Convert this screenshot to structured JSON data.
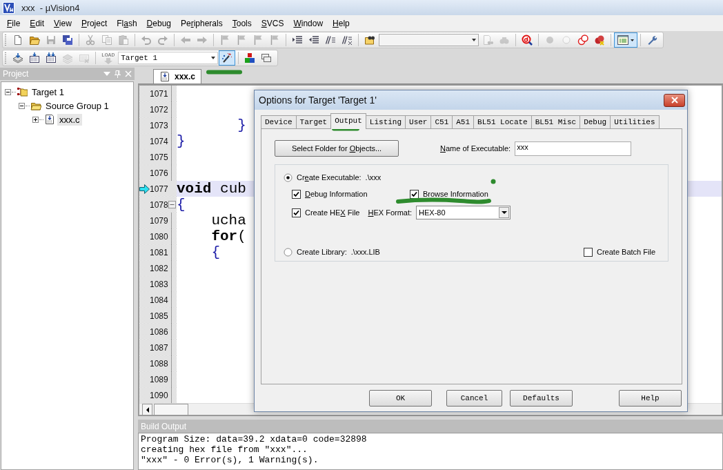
{
  "window": {
    "title": "xxx  - µVision4"
  },
  "menu": [
    {
      "key": "F",
      "tail": "ile"
    },
    {
      "key": "E",
      "tail": "dit"
    },
    {
      "key": "V",
      "tail": "iew"
    },
    {
      "key": "P",
      "tail": "roject"
    },
    {
      "lead": "Fl",
      "key": "a",
      "tail": "sh"
    },
    {
      "key": "D",
      "tail": "ebug"
    },
    {
      "lead": "Pe",
      "key": "r",
      "tail": "ipherals"
    },
    {
      "key": "T",
      "tail": "ools"
    },
    {
      "key": "S",
      "tail": "VCS"
    },
    {
      "key": "W",
      "tail": "indow"
    },
    {
      "key": "H",
      "tail": "elp"
    }
  ],
  "toolbars": [
    {
      "items": [
        {
          "kind": "new-file",
          "disabled": false,
          "selected": false
        },
        {
          "kind": "open",
          "disabled": false,
          "selected": false
        },
        {
          "kind": "save",
          "disabled": true,
          "selected": false
        },
        {
          "kind": "save-all",
          "disabled": false,
          "selected": false
        },
        {
          "kind": "separator"
        },
        {
          "kind": "cut",
          "disabled": true,
          "selected": false
        },
        {
          "kind": "copy",
          "disabled": true,
          "selected": false
        },
        {
          "kind": "paste",
          "disabled": true,
          "selected": false
        },
        {
          "kind": "separator"
        },
        {
          "kind": "undo",
          "disabled": true,
          "selected": false
        },
        {
          "kind": "redo",
          "disabled": true,
          "selected": false
        },
        {
          "kind": "separator"
        },
        {
          "kind": "back",
          "disabled": true,
          "selected": false
        },
        {
          "kind": "forward",
          "disabled": true,
          "selected": false
        },
        {
          "kind": "separator"
        },
        {
          "kind": "bookmark",
          "disabled": true,
          "selected": false
        },
        {
          "kind": "bookmark",
          "disabled": true,
          "selected": false
        },
        {
          "kind": "bookmark",
          "disabled": true,
          "selected": false
        },
        {
          "kind": "bookmark",
          "disabled": true,
          "selected": false
        },
        {
          "kind": "separator"
        },
        {
          "kind": "indent",
          "disabled": false,
          "selected": false
        },
        {
          "kind": "unindent",
          "disabled": false,
          "selected": false
        },
        {
          "kind": "comment",
          "disabled": false,
          "selected": false
        },
        {
          "kind": "uncomment",
          "disabled": false,
          "selected": false
        },
        {
          "kind": "separator"
        },
        {
          "kind": "find-in-files",
          "disabled": false,
          "selected": false
        },
        {
          "kind": "combo"
        },
        {
          "kind": "find",
          "disabled": true,
          "selected": false
        },
        {
          "kind": "replace",
          "disabled": true,
          "selected": false
        },
        {
          "kind": "separator"
        },
        {
          "kind": "debug",
          "disabled": false,
          "selected": false
        },
        {
          "kind": "separator"
        },
        {
          "kind": "breakpoint",
          "disabled": true,
          "selected": false
        },
        {
          "kind": "breakpoint-enable",
          "disabled": true,
          "selected": false
        },
        {
          "kind": "breakpoint-disable-all",
          "disabled": false,
          "selected": false
        },
        {
          "kind": "breakpoint-kill-all",
          "disabled": false,
          "selected": false
        },
        {
          "kind": "separator"
        },
        {
          "kind": "window",
          "disabled": false,
          "selected": true
        },
        {
          "kind": "separator"
        },
        {
          "kind": "wrench",
          "disabled": false,
          "selected": false
        }
      ]
    },
    {
      "items": [
        {
          "kind": "translate",
          "disabled": false,
          "selected": false
        },
        {
          "kind": "build",
          "disabled": false,
          "selected": false
        },
        {
          "kind": "rebuild",
          "disabled": false,
          "selected": false
        },
        {
          "kind": "batch-build",
          "disabled": true,
          "selected": false
        },
        {
          "kind": "stop-build",
          "disabled": true,
          "selected": false
        },
        {
          "kind": "separator"
        },
        {
          "kind": "load",
          "label": "LOAD",
          "disabled": true,
          "selected": false
        },
        {
          "kind": "combo",
          "value": "Target 1"
        },
        {
          "kind": "target-options",
          "disabled": false,
          "selected": true
        },
        {
          "kind": "separator"
        },
        {
          "kind": "pack-installer",
          "disabled": false,
          "selected": false
        },
        {
          "kind": "manage-books",
          "disabled": false,
          "selected": false
        }
      ]
    }
  ],
  "project_panel": {
    "title": "Project",
    "tree": [
      {
        "kind": "target",
        "label": "Target 1",
        "expanded": true,
        "selected": false,
        "children": [
          {
            "kind": "group",
            "label": "Source Group 1",
            "expanded": true,
            "selected": false,
            "children": [
              {
                "kind": "file",
                "label": "xxx.c",
                "expanded": false,
                "selected": true
              }
            ]
          }
        ]
      }
    ]
  },
  "editor": {
    "tabs": [
      {
        "label": "xxx.c",
        "selected": true
      }
    ],
    "lines": [
      {
        "number": "1071",
        "current": false,
        "region_start": false
      },
      {
        "number": "1072",
        "current": false,
        "region_start": false
      },
      {
        "number": "1073",
        "current": false,
        "region_start": false,
        "tokens": [
          {
            "kind": "brace",
            "text": "       }"
          }
        ]
      },
      {
        "number": "1074",
        "current": false,
        "region_start": false,
        "tokens": [
          {
            "kind": "brace",
            "text": "}"
          }
        ]
      },
      {
        "number": "1075",
        "current": false,
        "region_start": false
      },
      {
        "number": "1076",
        "current": false,
        "region_start": false
      },
      {
        "number": "1077",
        "current": true,
        "region_start": false,
        "tokens": [
          {
            "kind": "keyword",
            "text": "void"
          },
          {
            "kind": "ident",
            "text": " cub"
          }
        ]
      },
      {
        "number": "1078",
        "current": false,
        "region_start": true,
        "tokens": [
          {
            "kind": "brace",
            "text": "{"
          }
        ]
      },
      {
        "number": "1079",
        "current": false,
        "region_start": false,
        "tokens": [
          {
            "kind": "ident",
            "text": "    ucha"
          }
        ]
      },
      {
        "number": "1080",
        "current": false,
        "region_start": false,
        "tokens": [
          {
            "kind": "keyword",
            "text": "    for"
          },
          {
            "kind": "ident",
            "text": "("
          }
        ]
      },
      {
        "number": "1081",
        "current": false,
        "region_start": false,
        "tokens": [
          {
            "kind": "brace",
            "text": "    {"
          }
        ]
      },
      {
        "number": "1082",
        "current": false,
        "region_start": false
      },
      {
        "number": "1083",
        "current": false,
        "region_start": false
      },
      {
        "number": "1084",
        "current": false,
        "region_start": false
      },
      {
        "number": "1085",
        "current": false,
        "region_start": false
      },
      {
        "number": "1086",
        "current": false,
        "region_start": false
      },
      {
        "number": "1087",
        "current": false,
        "region_start": false
      },
      {
        "number": "1088",
        "current": false,
        "region_start": false
      },
      {
        "number": "1089",
        "current": false,
        "region_start": false
      },
      {
        "number": "1090",
        "current": false,
        "region_start": false
      }
    ]
  },
  "dialog": {
    "title": "Options for Target 'Target 1'",
    "tabs": [
      {
        "label": "Device",
        "selected": false
      },
      {
        "label": "Target",
        "selected": false
      },
      {
        "label": "Output",
        "selected": true
      },
      {
        "label": "Listing",
        "selected": false
      },
      {
        "label": "User",
        "selected": false
      },
      {
        "label": "C51",
        "selected": false
      },
      {
        "label": "A51",
        "selected": false
      },
      {
        "label": "BL51 Locate",
        "selected": false
      },
      {
        "label": "BL51 Misc",
        "selected": false
      },
      {
        "label": "Debug",
        "selected": false
      },
      {
        "label": "Utilities",
        "selected": false
      }
    ],
    "folder_button": {
      "lead": "Select Folder for ",
      "key": "O",
      "tail": "bjects..."
    },
    "name_label": {
      "key": "N",
      "tail": "ame of Executable:"
    },
    "name_value": "xxx",
    "create_executable": {
      "selected": true,
      "label": {
        "lead": "Cr",
        "key": "e",
        "tail": "ate Executable:"
      },
      "path": ".\\xxx"
    },
    "options": [
      {
        "label": {
          "key": "D",
          "tail": "ebug Information"
        },
        "checked": true
      },
      {
        "label": {
          "text": "Browse Information"
        },
        "checked": true
      },
      {
        "label": {
          "lead": "Create HE",
          "key": "X",
          "tail": " File"
        },
        "checked": true
      }
    ],
    "hex_format": {
      "label": {
        "key": "H",
        "tail": "EX Format:"
      },
      "value": "HEX-80"
    },
    "create_library": {
      "selected": false,
      "label": {
        "text": "Create Library:"
      },
      "path": ".\\xxx.LIB"
    },
    "batch_file": {
      "label": {
        "text": "Create Batch File"
      },
      "checked": false
    },
    "buttons": [
      "OK",
      "Cancel",
      "Defaults",
      "Help"
    ]
  },
  "build_output": {
    "title": "Build Output",
    "lines": [
      "Program Size: data=39.2 xdata=0 code=32898",
      "creating hex file from \"xxx\"...",
      "\"xxx\" - 0 Error(s), 1 Warning(s)."
    ]
  }
}
